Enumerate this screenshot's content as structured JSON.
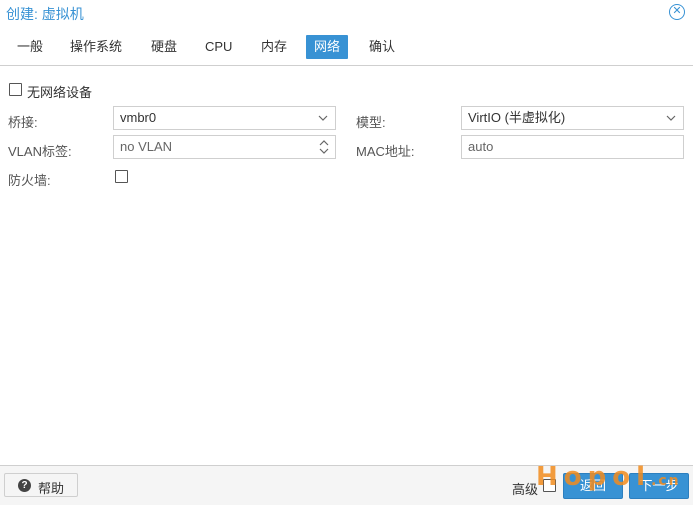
{
  "window": {
    "title": "创建: 虚拟机",
    "close_icon": "close-icon"
  },
  "tabs": [
    {
      "label": "一般"
    },
    {
      "label": "操作系统"
    },
    {
      "label": "硬盘"
    },
    {
      "label": "CPU"
    },
    {
      "label": "内存"
    },
    {
      "label": "网络",
      "active": true
    },
    {
      "label": "确认"
    }
  ],
  "network": {
    "no_network_device_label": "无网络设备",
    "no_network_device_checked": false,
    "bridge_label": "桥接:",
    "bridge_value": "vmbr0",
    "vlan_label": "VLAN标签:",
    "vlan_value": "no VLAN",
    "firewall_label": "防火墙:",
    "firewall_checked": false,
    "model_label": "模型:",
    "model_value": "VirtIO (半虚拟化)",
    "mac_label": "MAC地址:",
    "mac_value": "auto"
  },
  "footer": {
    "help_label": "帮助",
    "advanced_label": "高级",
    "advanced_checked": false,
    "back_label": "返回",
    "next_label": "下一步"
  },
  "watermark": {
    "text": "Hopol",
    "suffix": ".cn"
  },
  "colors": {
    "accent": "#3892d4",
    "border": "#cfcfcf",
    "footer_bg": "#f5f5f5",
    "watermark": "#f28c1e"
  }
}
